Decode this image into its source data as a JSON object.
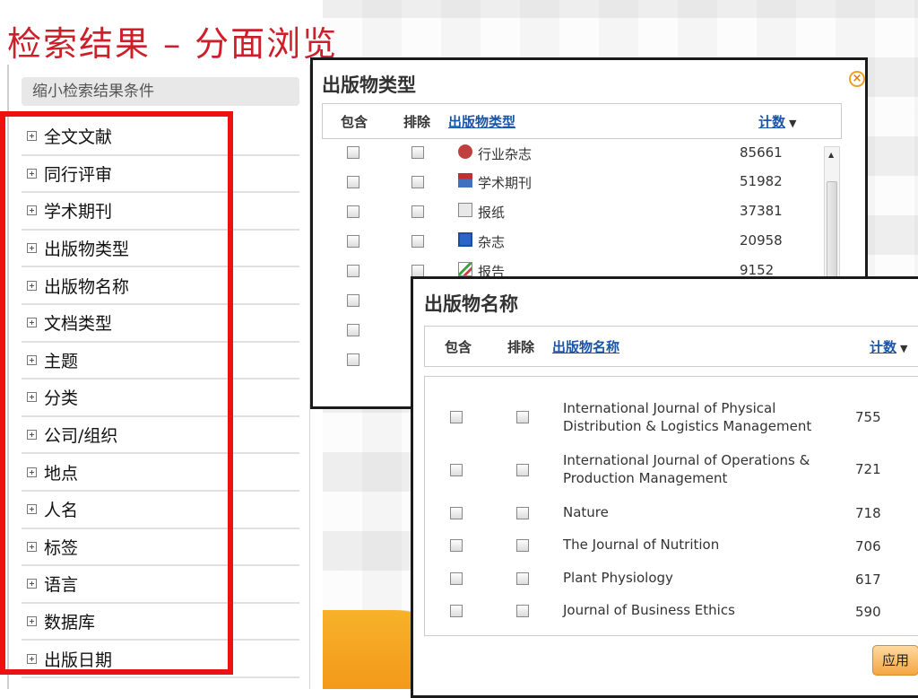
{
  "page_title": "检索结果 – 分面浏览",
  "left_panel": {
    "header": "缩小检索结果条件",
    "facets": [
      "全文文献",
      "同行评审",
      "学术期刊",
      "出版物类型",
      "出版物名称",
      "文档类型",
      "主题",
      "分类",
      "公司/组织",
      "地点",
      "人名",
      "标签",
      "语言",
      "数据库",
      "出版日期"
    ]
  },
  "type_dialog": {
    "title": "出版物类型",
    "col_include": "包含",
    "col_exclude": "排除",
    "col_name": "出版物类型",
    "col_count": "计数",
    "rows": [
      {
        "label": "行业杂志",
        "count": "85661",
        "icon": "trade-magazine-icon"
      },
      {
        "label": "学术期刊",
        "count": "51982",
        "icon": "scholarly-journal-icon"
      },
      {
        "label": "报纸",
        "count": "37381",
        "icon": "newspaper-icon"
      },
      {
        "label": "杂志",
        "count": "20958",
        "icon": "magazine-icon"
      },
      {
        "label": "报告",
        "count": "9152",
        "icon": "report-icon"
      }
    ]
  },
  "name_dialog": {
    "title": "出版物名称",
    "col_include": "包含",
    "col_exclude": "排除",
    "col_name": "出版物名称",
    "col_count": "计数",
    "rows": [
      {
        "line1": "International Journal of Physical",
        "line2": "Distribution & Logistics Management",
        "count": "755"
      },
      {
        "line1": "International Journal of Operations &",
        "line2": "Production Management",
        "count": "721"
      },
      {
        "line1": "Nature",
        "line2": "",
        "count": "718"
      },
      {
        "line1": "The Journal of Nutrition",
        "line2": "",
        "count": "706"
      },
      {
        "line1": "Plant Physiology",
        "line2": "",
        "count": "617"
      },
      {
        "line1": "Journal of Business Ethics",
        "line2": "",
        "count": "590"
      }
    ],
    "apply_label": "应用"
  },
  "colors": {
    "title_red": "#cc1f2a",
    "highlight_red": "#ee1111",
    "link_blue": "#1a55a8",
    "accent_orange": "#f3991a"
  }
}
